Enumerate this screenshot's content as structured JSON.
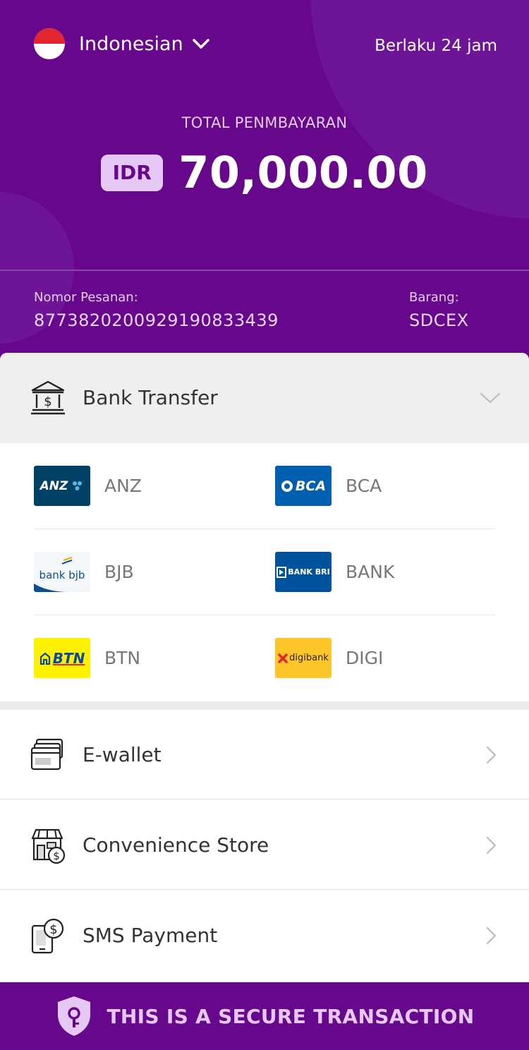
{
  "header": {
    "language": "Indonesian",
    "validity": "Berlaku 24 jam",
    "total_label": "TOTAL PENMBAYARAN",
    "currency": "IDR",
    "amount": "70,000.00",
    "order_label": "Nomor Pesanan:",
    "order_number": "8773820200929190833439",
    "item_label": "Barang:",
    "item_value": "SDCEX"
  },
  "bank_transfer": {
    "title": "Bank Transfer",
    "banks": [
      {
        "name": "ANZ",
        "logo_text": "ANZ"
      },
      {
        "name": "BCA",
        "logo_text": "BCA"
      },
      {
        "name": "BJB",
        "logo_text": "bank bjb"
      },
      {
        "name": "BANK",
        "logo_text": "BANK BRI"
      },
      {
        "name": "BTN",
        "logo_text": "BTN"
      },
      {
        "name": "DIGI",
        "logo_text": "digibank"
      }
    ]
  },
  "methods": [
    {
      "label": "E-wallet",
      "icon": "wallet-icon"
    },
    {
      "label": "Convenience Store",
      "icon": "store-icon"
    },
    {
      "label": "SMS Payment",
      "icon": "sms-payment-icon"
    }
  ],
  "footer": {
    "secure_text": "THIS IS A SECURE TRANSACTION"
  },
  "colors": {
    "primary": "#66078c",
    "accent": "#e5c8f5"
  }
}
